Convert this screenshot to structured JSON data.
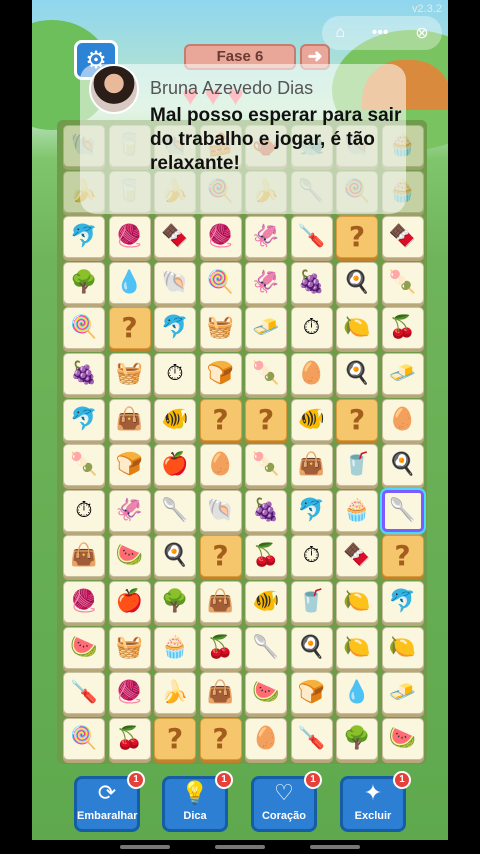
{
  "status": {
    "version": "v2.3.2"
  },
  "header": {
    "level_label": "Fase 6",
    "next_arrow": "➜",
    "settings_icon": "⚙",
    "mini_home": "⌂",
    "mini_more": "•••",
    "mini_close": "⊗",
    "hearts": [
      "♥",
      "♥",
      "♥"
    ]
  },
  "comment": {
    "username": "Bruna Azevedo Dias",
    "text": "Mal posso esperar para sair do trabalho e jogar, é tão relaxante!"
  },
  "board": {
    "rows": [
      [
        "🐚",
        "🥛",
        "🐚",
        "🍰",
        "🫖",
        "🐋",
        "🐚",
        "🧁"
      ],
      [
        "🍌",
        "🥛",
        "🍌",
        "🍭",
        "🍌",
        "🥄",
        "🍭",
        "🧁"
      ],
      [
        "🐬",
        "🧶",
        "🍫",
        "🧶",
        "🦑",
        "🪛",
        "?",
        "🍫"
      ],
      [
        "🌳",
        "💧",
        "🐚",
        "🍭",
        "🦑",
        "🍇",
        "🍳",
        "🍡"
      ],
      [
        "🍭",
        "?",
        "🐬",
        "🧺",
        "🧈",
        "⏱",
        "🍋",
        "🍒"
      ],
      [
        "🍇",
        "🧺",
        "⏱",
        "🍞",
        "🍡",
        "🥚",
        "🍳",
        "🧈"
      ],
      [
        "🐬",
        "👜",
        "🐠",
        "?",
        "?",
        "🐠",
        "?",
        "🥚"
      ],
      [
        "🍡",
        "🍞",
        "🍎",
        "🥚",
        "🍡",
        "👜",
        "🥤",
        "🍳"
      ],
      [
        "⏱",
        "🦑",
        "🥄",
        "🐚",
        "🍇",
        "🐬",
        "🧁",
        "🥄"
      ],
      [
        "👜",
        "🍉",
        "🍳",
        "?",
        "🍒",
        "⏱",
        "🍫",
        "?"
      ],
      [
        "🧶",
        "🍎",
        "🌳",
        "👜",
        "🐠",
        "🥤",
        "🍋",
        "🐬"
      ],
      [
        "🍉",
        "🧺",
        "🧁",
        "🍒",
        "🥄",
        "🍳",
        "🍋",
        "🍋"
      ],
      [
        "🪛",
        "🧶",
        "🍌",
        "👜",
        "🍉",
        "🍞",
        "💧",
        "🧈"
      ],
      [
        "🍭",
        "🍒",
        "?",
        "?",
        "🥚",
        "🪛",
        "🌳",
        "🍉"
      ]
    ],
    "selected": {
      "row": 8,
      "col": 7
    }
  },
  "powerups": [
    {
      "label": "Embaralhar",
      "icon": "⟳",
      "count": "1"
    },
    {
      "label": "Dica",
      "icon": "💡",
      "count": "1"
    },
    {
      "label": "Coração",
      "icon": "♡",
      "count": "1"
    },
    {
      "label": "Excluir",
      "icon": "✦",
      "count": "1"
    }
  ],
  "colors": {
    "tile_face": "#fbf6de",
    "mystery_tile": "#f6c66c",
    "powerup_blue": "#2d7fd3",
    "badge_red": "#e5403a",
    "board_green": "#6f9b4b"
  }
}
